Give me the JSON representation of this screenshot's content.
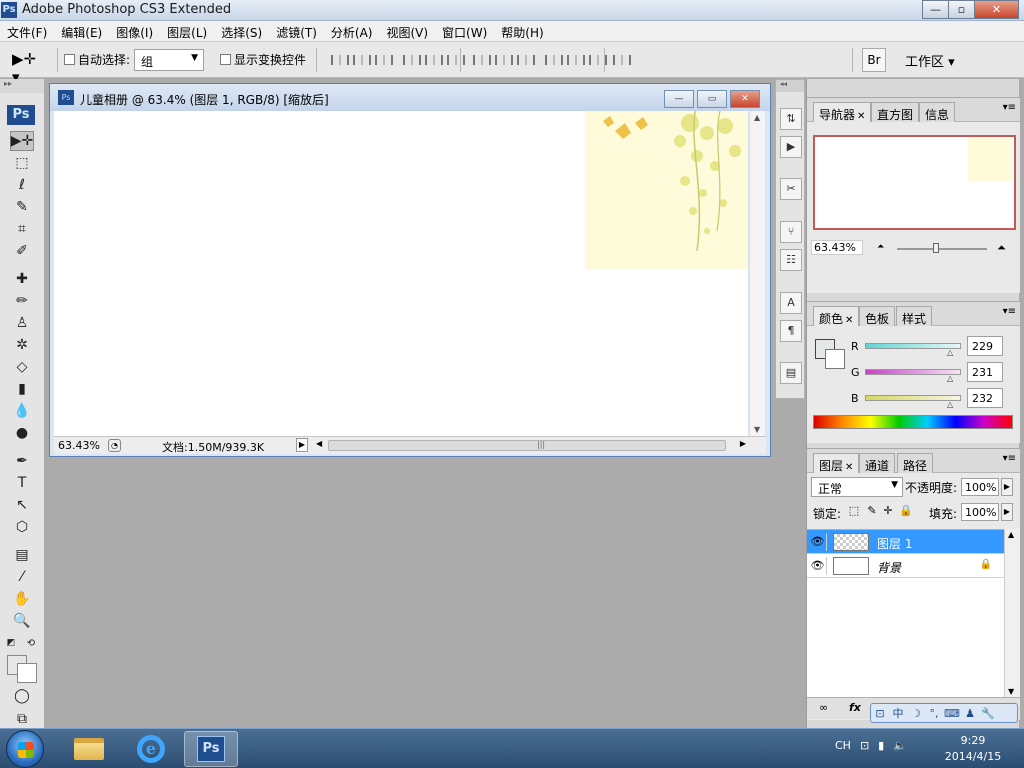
{
  "app": {
    "title": "Adobe Photoshop CS3 Extended",
    "logo": "Ps",
    "window_buttons": {
      "minimize": "—",
      "maximize": "▫",
      "close": "✕"
    }
  },
  "menu": [
    "文件(F)",
    "编辑(E)",
    "图像(I)",
    "图层(L)",
    "选择(S)",
    "滤镜(T)",
    "分析(A)",
    "视图(V)",
    "窗口(W)",
    "帮助(H)"
  ],
  "options_bar": {
    "tool_icon": "move-tool-icon",
    "auto_select_label": "自动选择:",
    "auto_select_value": "组",
    "show_transform_label": "显示变换控件",
    "workspace_label": "工作区 ▾"
  },
  "toolbox": {
    "logo": "Ps",
    "tools": [
      "▶✛",
      "⬚",
      "ℓ",
      "✎",
      "⌗",
      "✐",
      "✚",
      "✏",
      "♙",
      "✲",
      "◇",
      "▮",
      "💧",
      "●",
      "✒",
      "T",
      "↖",
      "⬡",
      "▤",
      "⁄",
      "✋",
      "🔍",
      "◩",
      "⟲",
      "◯",
      "⧉"
    ]
  },
  "document": {
    "title": "儿童相册 @ 63.4% (图层 1, RGB/8) [缩放后]",
    "zoom": "63.43%",
    "doc_info": "文档:1.50M/939.3K"
  },
  "iconstrip": [
    "⇅",
    "▶",
    "✂",
    "⑂",
    "☷",
    "A",
    "¶",
    "▤"
  ],
  "navigator": {
    "tabs": [
      "导航器",
      "直方图",
      "信息"
    ],
    "zoom": "63.43%"
  },
  "color_panel": {
    "tabs": [
      "颜色",
      "色板",
      "样式"
    ],
    "channels": [
      {
        "label": "R",
        "value": "229",
        "gradient": "linear-gradient(90deg,#5fd6d6,#e6f6f6)"
      },
      {
        "label": "G",
        "value": "231",
        "gradient": "linear-gradient(90deg,#c842c8,#f5e6f5)"
      },
      {
        "label": "B",
        "value": "232",
        "gradient": "linear-gradient(90deg,#d8d860,#f5f5e0)"
      }
    ]
  },
  "layers_panel": {
    "tabs": [
      "图层",
      "通道",
      "路径"
    ],
    "blend_mode": "正常",
    "opacity_label": "不透明度:",
    "opacity": "100%",
    "lock_label": "锁定:",
    "fill_label": "填充:",
    "fill": "100%",
    "layers": [
      {
        "name": "图层 1",
        "selected": true
      },
      {
        "name": "背景",
        "selected": false
      }
    ]
  },
  "ime": [
    "⊡",
    "中",
    "☽",
    "°,",
    "⌨",
    "♟",
    "🔧"
  ],
  "tray": {
    "lang": "CH",
    "time": "9:29",
    "date": "2014/4/15"
  },
  "colors": {
    "selection": "#3399ff",
    "canvas_art": "#fdfbd9"
  }
}
